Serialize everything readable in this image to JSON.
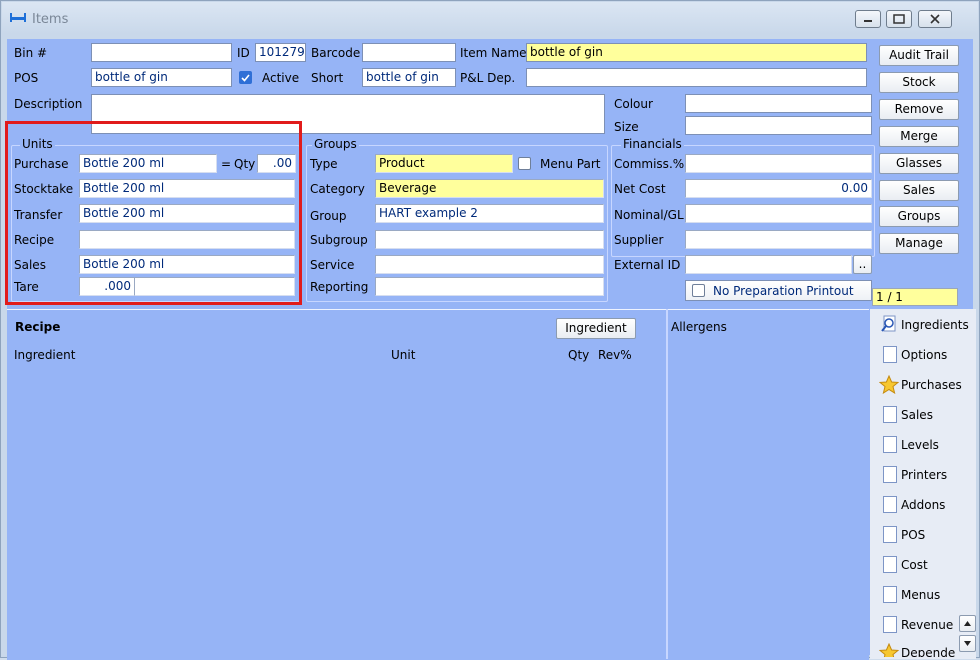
{
  "window": {
    "title": "Items"
  },
  "header": {
    "bin_label": "Bin #",
    "bin_value": "",
    "id_label": "ID",
    "id_value": "101279",
    "barcode_label": "Barcode",
    "barcode_value": "",
    "item_name_label": "Item Name",
    "item_name_value": "bottle of gin",
    "pos_label": "POS",
    "pos_value": "bottle of gin",
    "active_label": "Active",
    "active_checked": true,
    "short_label": "Short",
    "short_value": "bottle of gin",
    "pl_label": "P&L Dep.",
    "pl_value": "",
    "description_label": "Description",
    "description_value": "",
    "colour_label": "Colour",
    "colour_value": "",
    "size_label": "Size",
    "size_value": ""
  },
  "units": {
    "group_label": "Units",
    "purchase_label": "Purchase",
    "purchase_value": "Bottle 200 ml",
    "eq": "=",
    "qty_label": "Qty",
    "qty_value": ".00",
    "stocktake_label": "Stocktake",
    "stocktake_value": "Bottle 200 ml",
    "transfer_label": "Transfer",
    "transfer_value": "Bottle 200 ml",
    "recipe_label": "Recipe",
    "recipe_value": "",
    "sales_label": "Sales",
    "sales_value": "Bottle 200 ml",
    "tare_label": "Tare",
    "tare_value": ".000"
  },
  "groups": {
    "group_label": "Groups",
    "type_label": "Type",
    "type_value": "Product",
    "menu_part_label": "Menu Part",
    "category_label": "Category",
    "category_value": "Beverage",
    "group_label2": "Group",
    "group_value": "HART example 2",
    "subgroup_label": "Subgroup",
    "subgroup_value": "",
    "service_label": "Service",
    "service_value": "",
    "reporting_label": "Reporting",
    "reporting_value": ""
  },
  "financials": {
    "group_label": "Financials",
    "commiss_label": "Commiss.%",
    "commiss_value": "",
    "net_cost_label": "Net Cost",
    "net_cost_value": "0.00",
    "nominal_label": "Nominal/GL",
    "nominal_value": "",
    "supplier_label": "Supplier",
    "supplier_value": "",
    "external_id_label": "External ID",
    "external_id_value": "",
    "ellipsis": "..",
    "no_prep_label": "No Preparation Printout",
    "record_counter": "1 / 1"
  },
  "buttons": [
    "Audit Trail",
    "Stock",
    "Remove",
    "Merge",
    "Glasses",
    "Sales",
    "Groups",
    "Manage"
  ],
  "recipe": {
    "title": "Recipe",
    "ingredient_button": "Ingredient",
    "col_ingredient": "Ingredient",
    "col_unit": "Unit",
    "col_qty": "Qty",
    "col_rev": "Rev%",
    "allergens_label": "Allergens"
  },
  "side_tabs": [
    {
      "label": "Ingredients",
      "icon": "search-doc-icon"
    },
    {
      "label": "Options",
      "icon": "page-icon"
    },
    {
      "label": "Purchases",
      "icon": "star-icon"
    },
    {
      "label": "Sales",
      "icon": "page-icon"
    },
    {
      "label": "Levels",
      "icon": "page-icon"
    },
    {
      "label": "Printers",
      "icon": "page-icon"
    },
    {
      "label": "Addons",
      "icon": "page-icon"
    },
    {
      "label": "POS",
      "icon": "page-icon"
    },
    {
      "label": "Cost",
      "icon": "page-icon"
    },
    {
      "label": "Menus",
      "icon": "page-icon"
    },
    {
      "label": "Revenue",
      "icon": "page-icon"
    },
    {
      "label": "Dependen",
      "icon": "star-icon"
    }
  ],
  "colors": {
    "highlight": "#e11b1b",
    "required_field": "#ffff9c",
    "panel": "#96b4f6"
  }
}
